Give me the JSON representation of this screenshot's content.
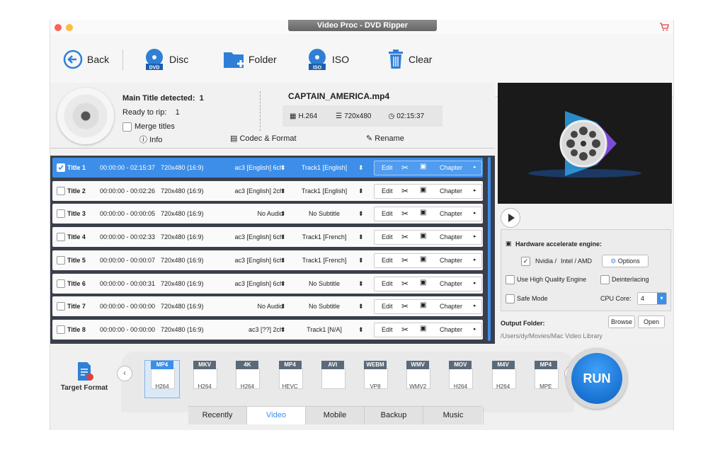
{
  "window": {
    "title": "Video Proc - DVD Ripper"
  },
  "toolbar": {
    "back": "Back",
    "disc": "Disc",
    "folder": "Folder",
    "iso": "ISO",
    "clear": "Clear"
  },
  "main_info": {
    "detected_label": "Main Title detected:",
    "detected_value": "1",
    "ready_label": "Ready to rip:",
    "ready_value": "1",
    "merge_label": "Merge titles"
  },
  "file": {
    "name": "CAPTAIN_AMERICA.mp4",
    "codec": "H.264",
    "resolution": "720x480",
    "duration": "02:15:37"
  },
  "subtabs": {
    "info": "Info",
    "codec": "Codec & Format",
    "rename": "Rename"
  },
  "titles": [
    {
      "name": "Title 1",
      "time": "00:00:00 - 02:15:37",
      "res": "720x480 (16:9)",
      "audio": "ac3 [English] 6ch",
      "sub": "Track1 [English]",
      "edit": "Edit",
      "chapter": "Chapter",
      "checked": true
    },
    {
      "name": "Title 2",
      "time": "00:00:00 - 00:02:26",
      "res": "720x480 (16:9)",
      "audio": "ac3 [English] 2ch",
      "sub": "Track1 [English]",
      "edit": "Edit",
      "chapter": "Chapter",
      "checked": false
    },
    {
      "name": "Title 3",
      "time": "00:00:00 - 00:00:05",
      "res": "720x480 (16:9)",
      "audio": "No Audio",
      "sub": "No Subtitle",
      "edit": "Edit",
      "chapter": "Chapter",
      "checked": false
    },
    {
      "name": "Title 4",
      "time": "00:00:00 - 00:02:33",
      "res": "720x480 (16:9)",
      "audio": "ac3 [English] 6ch",
      "sub": "Track1 [French]",
      "edit": "Edit",
      "chapter": "Chapter",
      "checked": false
    },
    {
      "name": "Title 5",
      "time": "00:00:00 - 00:00:07",
      "res": "720x480 (16:9)",
      "audio": "ac3 [English] 6ch",
      "sub": "Track1 [French]",
      "edit": "Edit",
      "chapter": "Chapter",
      "checked": false
    },
    {
      "name": "Title 6",
      "time": "00:00:00 - 00:00:31",
      "res": "720x480 (16:9)",
      "audio": "ac3 [English] 6ch",
      "sub": "No Subtitle",
      "edit": "Edit",
      "chapter": "Chapter",
      "checked": false
    },
    {
      "name": "Title 7",
      "time": "00:00:00 - 00:00:00",
      "res": "720x480 (16:9)",
      "audio": "No Audio",
      "sub": "No Subtitle",
      "edit": "Edit",
      "chapter": "Chapter",
      "checked": false
    },
    {
      "name": "Title 8",
      "time": "00:00:00 - 00:00:00",
      "res": "720x480 (16:9)",
      "audio": "ac3 [??] 2ch",
      "sub": "Track1 [N/A]",
      "edit": "Edit",
      "chapter": "Chapter",
      "checked": false
    }
  ],
  "settings": {
    "hw_label": "Hardware accelerate engine:",
    "nvidia": "Nvidia /",
    "intel_amd": "Intel / AMD",
    "options": "Options",
    "hq": "Use High Quality Engine",
    "deinterlace": "Deinterlacing",
    "safe": "Safe Mode",
    "cpu_label": "CPU Core:",
    "cpu_value": "4"
  },
  "output": {
    "label": "Output Folder:",
    "browse": "Browse",
    "open": "Open",
    "path": "/Users/dy/Movies/Mac Video Library"
  },
  "target_format_label": "Target Format",
  "formats": [
    {
      "top": "MP4",
      "sub": "H264"
    },
    {
      "top": "MKV",
      "sub": "H264"
    },
    {
      "top": "4K",
      "sub": "H264"
    },
    {
      "top": "MP4",
      "sub": "HEVC"
    },
    {
      "top": "AVI",
      "sub": ""
    },
    {
      "top": "WEBM",
      "sub": "VP8"
    },
    {
      "top": "WMV",
      "sub": "WMV2"
    },
    {
      "top": "MOV",
      "sub": "H264"
    },
    {
      "top": "M4V",
      "sub": "H264"
    },
    {
      "top": "MP4",
      "sub": "MPE"
    }
  ],
  "bottom_tabs": [
    "Recently",
    "Video",
    "Mobile",
    "Backup",
    "Music"
  ],
  "run_label": "RUN",
  "colors": {
    "accent": "#3d8ee8",
    "selected_row": "#3d8ee8",
    "list_bg": "#3a3f4b"
  }
}
